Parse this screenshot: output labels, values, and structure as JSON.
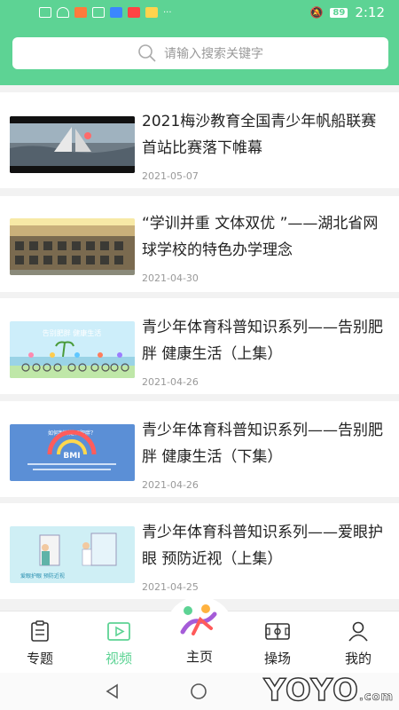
{
  "status_bar": {
    "time": "2:12",
    "battery": "89"
  },
  "search": {
    "placeholder": "请输入搜索关键字"
  },
  "news": [
    {
      "title": "2021梅沙教育全国青少年帆船联赛首站比赛落下帷幕",
      "date": "2021-05-07"
    },
    {
      "title": "“学训并重 文体双优 ”——湖北省网球学校的特色办学理念",
      "date": "2021-04-30"
    },
    {
      "title": "青少年体育科普知识系列——告别肥胖 健康生活（上集）",
      "date": "2021-04-26"
    },
    {
      "title": "青少年体育科普知识系列——告别肥胖 健康生活（下集）",
      "date": "2021-04-26"
    },
    {
      "title": "青少年体育科普知识系列——爱眼护眼 预防近视（上集）",
      "date": "2021-04-25"
    }
  ],
  "thumbnails": {
    "t3": "告别肥胖 健康生活",
    "t4_title": "如何判断是否肥胖？",
    "t4_bmi": "BMI",
    "t5": "爱眼护眼 预防近视"
  },
  "bottom_nav": {
    "items": [
      "专题",
      "视频",
      "主页",
      "操场",
      "我的"
    ],
    "active": "视频",
    "active_color": "#5dd394"
  },
  "watermark": {
    "text": "YOYO",
    "suffix": ".com"
  },
  "colors": {
    "brand_green": "#5dd394"
  }
}
